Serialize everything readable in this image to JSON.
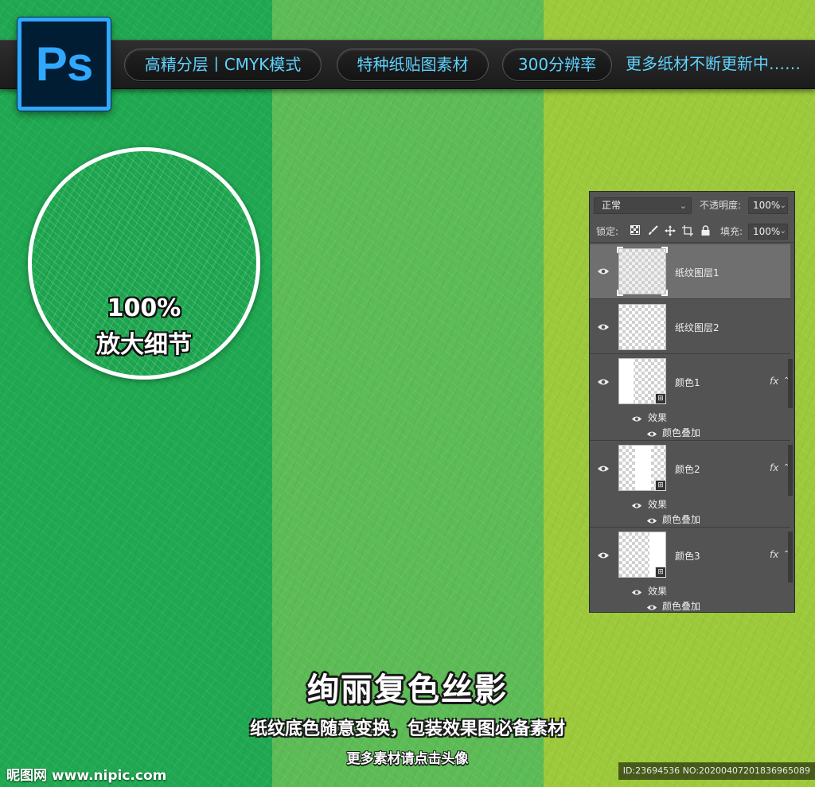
{
  "colors": {
    "stripe_left": "#1fa851",
    "stripe_middle": "#5cbb55",
    "stripe_right": "#9cc93a",
    "banner_text": "#5fd3ff",
    "ps_blue": "#31a8ff",
    "panel_bg": "#535353"
  },
  "banner": {
    "logo_text": "Ps",
    "pills": [
      "高精分层丨CMYK模式",
      "特种纸贴图素材",
      "300分辨率"
    ],
    "more_text": "更多纸材不断更新中……"
  },
  "zoom": {
    "percent": "100%",
    "label": "放大细节"
  },
  "layers_panel": {
    "blend_mode": "正常",
    "opacity_label": "不透明度:",
    "opacity_value": "100%",
    "lock_label": "锁定:",
    "fill_label": "填充:",
    "fill_value": "100%",
    "lock_icons": [
      "lock-transparent-icon",
      "lock-brush-icon",
      "lock-move-icon",
      "lock-artboard-icon",
      "lock-all-icon"
    ],
    "layers": [
      {
        "name": "纸纹图层1",
        "selected": true
      },
      {
        "name": "纸纹图层2",
        "selected": false
      },
      {
        "name": "颜色1",
        "fx": "fx",
        "effects_label": "效果",
        "effect": "颜色叠加"
      },
      {
        "name": "颜色2",
        "fx": "fx",
        "effects_label": "效果",
        "effect": "颜色叠加"
      },
      {
        "name": "颜色3",
        "fx": "fx",
        "effects_label": "效果",
        "effect": "颜色叠加"
      }
    ]
  },
  "bottom": {
    "headline": "绚丽复色丝影",
    "subline": "纸纹底色随意变换，包装效果图必备素材",
    "subline2": "更多素材请点击头像",
    "watermark_left": "昵图网 www.nipic.com",
    "watermark_right": "ID:23694536 NO:20200407201836965089"
  }
}
